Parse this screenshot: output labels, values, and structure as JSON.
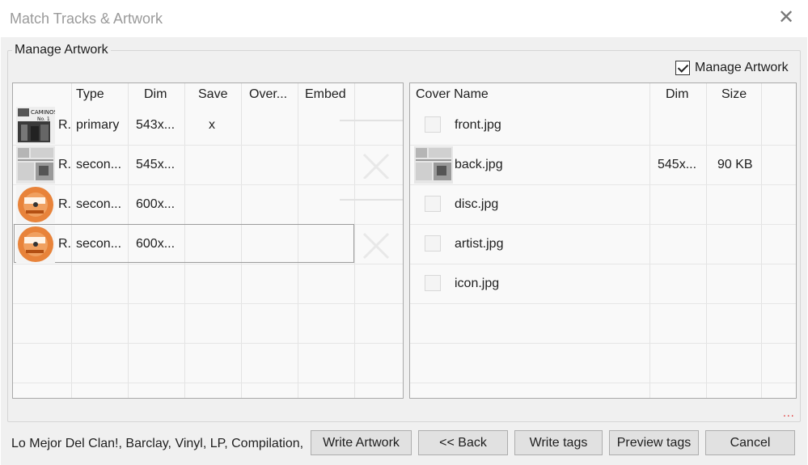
{
  "window": {
    "title": "Match Tracks & Artwork",
    "close_glyph": "✕"
  },
  "group": {
    "label": "Manage Artwork",
    "checkbox_label": "Manage Artwork",
    "checkbox_checked": true
  },
  "left_table": {
    "headers": [
      "Type",
      "Dim",
      "Save",
      "Over...",
      "Embed"
    ],
    "rows": [
      {
        "prefix": "R.",
        "type": "primary",
        "dim": "543x...",
        "save": "x",
        "over": "",
        "embed": "",
        "thumb": "album-cover-bw"
      },
      {
        "prefix": "R.",
        "type": "secon...",
        "dim": "545x...",
        "save": "",
        "over": "",
        "embed": "",
        "thumb": "album-back"
      },
      {
        "prefix": "R.",
        "type": "secon...",
        "dim": "600x...",
        "save": "",
        "over": "",
        "embed": "",
        "thumb": "orange-disc"
      },
      {
        "prefix": "R.",
        "type": "secon...",
        "dim": "600x...",
        "save": "",
        "over": "",
        "embed": "",
        "thumb": "orange-disc"
      }
    ]
  },
  "right_table": {
    "headers": [
      "Cover Name",
      "Dim",
      "Size"
    ],
    "rows": [
      {
        "name": "front.jpg",
        "dim": "",
        "size": "",
        "thumb": "placeholder"
      },
      {
        "name": "back.jpg",
        "dim": "545x...",
        "size": "90 KB",
        "thumb": "album-back"
      },
      {
        "name": "disc.jpg",
        "dim": "",
        "size": "",
        "thumb": "placeholder"
      },
      {
        "name": "artist.jpg",
        "dim": "",
        "size": "",
        "thumb": "placeholder"
      },
      {
        "name": "icon.jpg",
        "dim": "",
        "size": "",
        "thumb": "placeholder"
      }
    ]
  },
  "status": {
    "text": "Lo Mejor Del Clan!, Barclay, Vinyl, LP, Compilation,",
    "more_glyph": "..."
  },
  "buttons": {
    "write_artwork": "Write Artwork",
    "back": "<< Back",
    "write_tags": "Write tags",
    "preview_tags": "Preview tags",
    "cancel": "Cancel"
  },
  "colors": {
    "accent_dots": "#e02020",
    "panel_bg": "#f9f9f9",
    "dialog_bg": "#f0f0f0"
  }
}
